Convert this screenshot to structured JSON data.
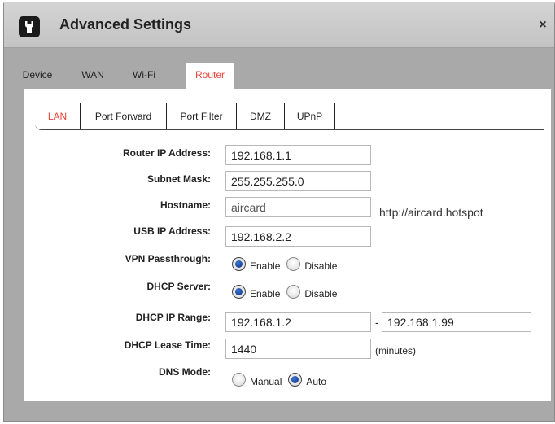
{
  "window": {
    "title": "Advanced Settings",
    "close_glyph": "×",
    "title_icon": "wrench-icon"
  },
  "tabs": [
    {
      "label": "Device",
      "active": false
    },
    {
      "label": "WAN",
      "active": false
    },
    {
      "label": "Wi-Fi",
      "active": false
    },
    {
      "label": "Router",
      "active": true
    }
  ],
  "subtabs": [
    {
      "label": "LAN",
      "active": true
    },
    {
      "label": "Port Forward",
      "active": false
    },
    {
      "label": "Port Filter",
      "active": false
    },
    {
      "label": "DMZ",
      "active": false
    },
    {
      "label": "UPnP",
      "active": false
    }
  ],
  "form": {
    "router_ip": {
      "label": "Router IP Address:",
      "value": "192.168.1.1"
    },
    "subnet": {
      "label": "Subnet Mask:",
      "value": "255.255.255.0"
    },
    "hostname": {
      "label": "Hostname:",
      "value": "aircard",
      "hint": "http://aircard.hotspot"
    },
    "usb_ip": {
      "label": "USB IP Address:",
      "value": "192.168.2.2"
    },
    "vpn": {
      "label": "VPN Passthrough:",
      "options": [
        "Enable",
        "Disable"
      ],
      "selected": "Enable"
    },
    "dhcp_server": {
      "label": "DHCP Server:",
      "options": [
        "Enable",
        "Disable"
      ],
      "selected": "Enable"
    },
    "dhcp_range": {
      "label": "DHCP IP Range:",
      "start": "192.168.1.2",
      "separator": "-",
      "end": "192.168.1.99"
    },
    "lease": {
      "label": "DHCP Lease Time:",
      "value": "1440",
      "unit": "(minutes)"
    },
    "dns": {
      "label": "DNS Mode:",
      "options": [
        "Manual",
        "Auto"
      ],
      "selected": "Auto"
    }
  },
  "colors": {
    "active_tab_text": "#e8463c",
    "dialog_bg": "#a9a9a9",
    "radio_dot": "#1f4fa8"
  }
}
